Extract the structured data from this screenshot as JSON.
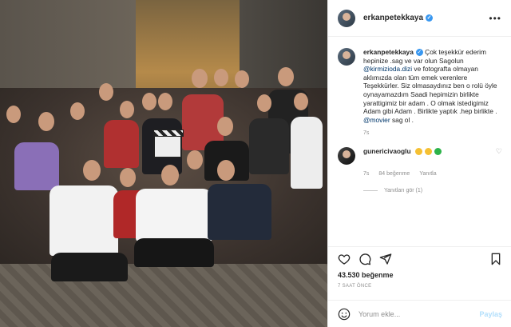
{
  "post": {
    "username": "erkanpetekkaya",
    "more_icon": "more-horizontal-icon"
  },
  "caption": {
    "username": "erkanpetekkaya",
    "part1": " Çok teşekkür ederim hepinize .sag ve var olun Sagolun ",
    "mention1": "@kirmizioda.dizi",
    "part2": " ve fotografta olmayan aklımızda olan tüm emek verenlere Teşekkürler. Siz olmasaydınız ben o rolü öyle oynayamazdım Saadi hepimizin birlikte yarattigimiz bir adam . O olmak istedigimiz Adam gibi Adam . Birlikte yaptık .hep birlikte . ",
    "mention2": "@movier",
    "part3": " sag ol .",
    "time": "7s"
  },
  "comment": {
    "username": "gunericivaoglu",
    "emojis": [
      "#f5c033",
      "#f5c033",
      "#2db34a"
    ],
    "time": "7s",
    "likes": "84 beğenme",
    "reply": "Yanıtla",
    "view_replies": "Yanıtları gör (1)"
  },
  "actions": {
    "likes_count": "43.530 beğenme",
    "posted_ago": "7 SAAT ÖNCE"
  },
  "add_comment": {
    "placeholder": "Yorum ekle...",
    "post_label": "Paylaş"
  },
  "colors": {
    "verified": "#3897f0",
    "mention": "#00376b",
    "post_disabled": "#b2dffc"
  }
}
